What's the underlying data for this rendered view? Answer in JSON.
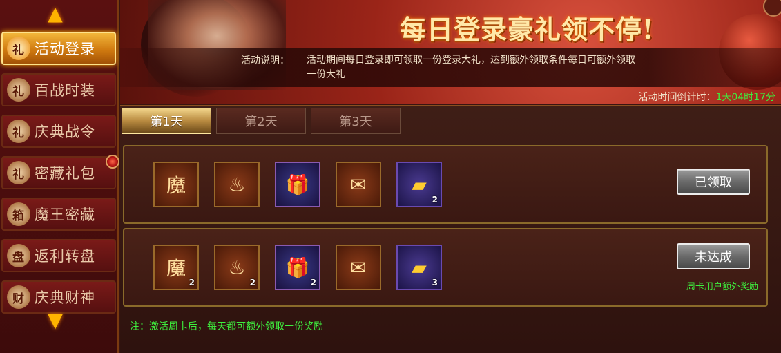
{
  "sidebar": {
    "items": [
      {
        "label": "活动登录",
        "icon_char": "礼",
        "active": true
      },
      {
        "label": "百战时装",
        "icon_char": "礼",
        "active": false
      },
      {
        "label": "庆典战令",
        "icon_char": "礼",
        "active": false
      },
      {
        "label": "密藏礼包",
        "icon_char": "礼",
        "active": false
      },
      {
        "label": "魔王密藏",
        "icon_char": "箱",
        "active": false
      },
      {
        "label": "返利转盘",
        "icon_char": "盘",
        "active": false
      },
      {
        "label": "庆典财神",
        "icon_char": "财",
        "active": false
      }
    ]
  },
  "banner": {
    "title": "每日登录豪礼领不停!",
    "desc_label": "活动说明：",
    "desc_text": "活动期间每日登录即可领取一份登录大礼，达到额外领取条件每日可额外领取一份大礼",
    "countdown_label": "活动时间倒计时：",
    "countdown_value": "1天04时17分"
  },
  "tabs": [
    {
      "label": "第1天",
      "active": true
    },
    {
      "label": "第2天",
      "active": false
    },
    {
      "label": "第3天",
      "active": false
    }
  ],
  "rows": [
    {
      "items": [
        {
          "icon": "demon-seal-icon",
          "glyph": "魔",
          "count": ""
        },
        {
          "icon": "red-gourd-icon",
          "glyph": "♨",
          "count": ""
        },
        {
          "icon": "gift-box-icon",
          "glyph": "🎁",
          "count": ""
        },
        {
          "icon": "token-tag-icon",
          "glyph": "✉",
          "count": ""
        },
        {
          "icon": "gold-ingot-icon",
          "glyph": "▰",
          "count": "2"
        }
      ],
      "button": "已领取"
    },
    {
      "items": [
        {
          "icon": "demon-seal-icon",
          "glyph": "魔",
          "count": "2"
        },
        {
          "icon": "red-gourd-icon",
          "glyph": "♨",
          "count": "2"
        },
        {
          "icon": "gift-box-icon",
          "glyph": "🎁",
          "count": "2"
        },
        {
          "icon": "token-tag-icon",
          "glyph": "✉",
          "count": ""
        },
        {
          "icon": "gold-ingot-icon",
          "glyph": "▰",
          "count": "3"
        }
      ],
      "button": "未达成",
      "extra_label": "周卡用户额外奖励"
    }
  ],
  "note": "注：激活周卡后，每天都可额外领取一份奖励",
  "colors": {
    "green": "#3eef3e",
    "gold": "#ffb400"
  }
}
